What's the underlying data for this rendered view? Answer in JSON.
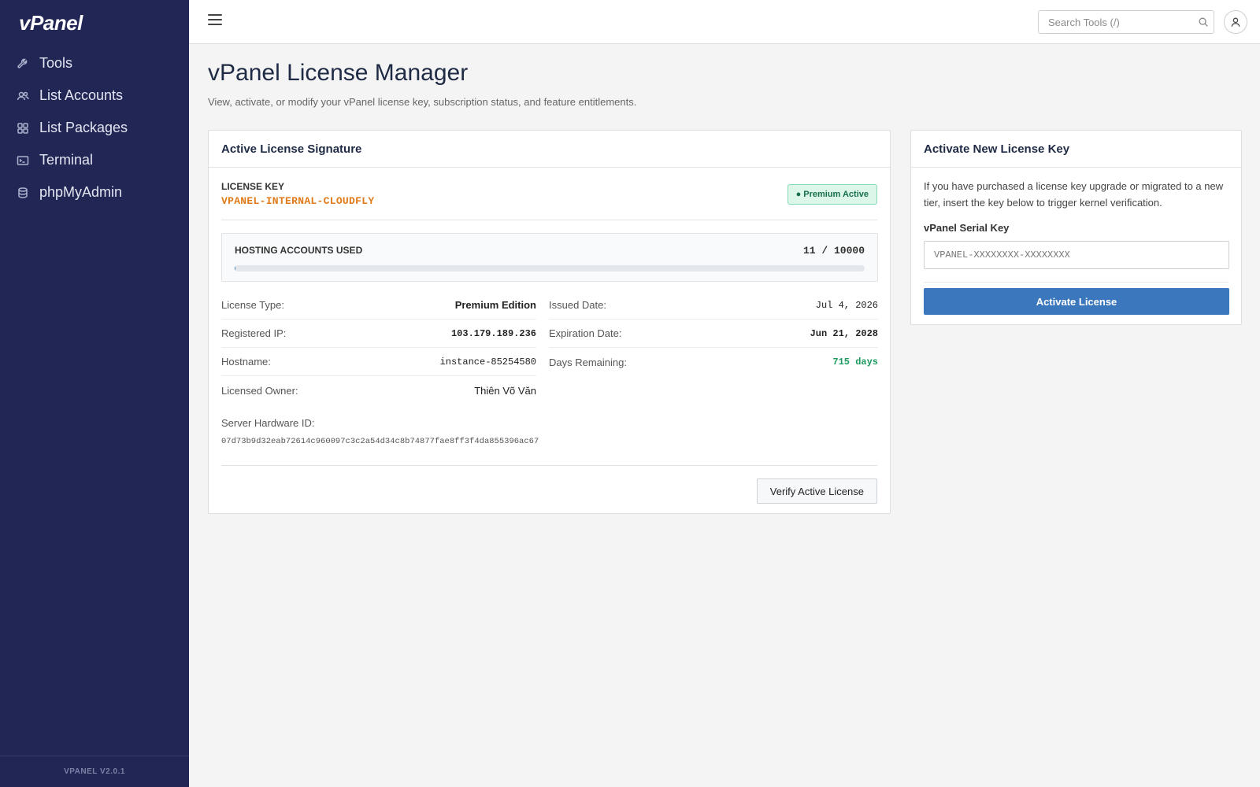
{
  "app": {
    "logo": "vPanel",
    "version": "VPANEL V2.0.1"
  },
  "sidebar": {
    "items": [
      {
        "label": "Tools",
        "icon": "wrench-icon"
      },
      {
        "label": "List Accounts",
        "icon": "users-icon"
      },
      {
        "label": "List Packages",
        "icon": "grid-icon"
      },
      {
        "label": "Terminal",
        "icon": "terminal-icon"
      },
      {
        "label": "phpMyAdmin",
        "icon": "database-icon"
      }
    ]
  },
  "topbar": {
    "search_placeholder": "Search Tools (/)"
  },
  "page": {
    "title": "vPanel License Manager",
    "subtitle": "View, activate, or modify your vPanel license key, subscription status, and feature entitlements."
  },
  "license_card": {
    "title": "Active License Signature",
    "key_label": "LICENSE KEY",
    "key_value": "VPANEL-INTERNAL-CLOUDFLY",
    "status_badge": "● Premium Active",
    "usage_label": "HOSTING ACCOUNTS USED",
    "usage_count": "11 / 10000",
    "usage_fraction": 0.0011,
    "rows": {
      "license_type": {
        "label": "License Type:",
        "value": "Premium Edition"
      },
      "registered_ip": {
        "label": "Registered IP:",
        "value": "103.179.189.236"
      },
      "hostname": {
        "label": "Hostname:",
        "value": "instance-85254580"
      },
      "owner": {
        "label": "Licensed Owner:",
        "value": "Thiên Võ Văn"
      },
      "issued": {
        "label": "Issued Date:",
        "value": "Jul 4, 2026"
      },
      "expiration": {
        "label": "Expiration Date:",
        "value": "Jun 21, 2028"
      },
      "remaining": {
        "label": "Days Remaining:",
        "value": "715 days"
      }
    },
    "hardware_label": "Server Hardware ID:",
    "hardware_id": "07d73b9d32eab72614c960097c3c2a54d34c8b74877fae8ff3f4da855396ac67",
    "verify_button": "Verify Active License"
  },
  "activate_card": {
    "title": "Activate New License Key",
    "description": "If you have purchased a license key upgrade or migrated to a new tier, insert the key below to trigger kernel verification.",
    "field_label": "vPanel Serial Key",
    "field_placeholder": "VPANEL-XXXXXXXX-XXXXXXXX",
    "button": "Activate License"
  },
  "colors": {
    "sidebar": "#212654",
    "accent": "#3b77bc",
    "key": "#e07a18",
    "success": "#1e9a5e"
  }
}
